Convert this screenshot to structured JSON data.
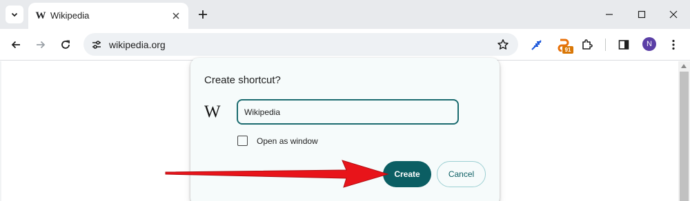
{
  "browser": {
    "tab": {
      "favicon": "W",
      "title": "Wikipedia"
    },
    "omnibox": {
      "url": "wikipedia.org"
    },
    "extension_badge": "91",
    "profile_initial": "N"
  },
  "icons": {
    "tab_search": "chevron-down-icon",
    "tab_close": "close-icon",
    "new_tab": "plus-icon",
    "minimize": "minimize-icon",
    "maximize": "maximize-icon",
    "close_window": "close-icon",
    "back": "arrow-left-icon",
    "forward": "arrow-right-icon",
    "reload": "reload-icon",
    "site_info": "tune-icon",
    "bookmark": "star-icon",
    "extension_1": "feather-icon",
    "extensions": "puzzle-icon",
    "side_panel": "side-panel-icon",
    "menu": "kebab-menu-icon"
  },
  "dialog": {
    "title": "Create shortcut?",
    "site_logo": "W",
    "name_value": "Wikipedia",
    "checkbox_label": "Open as window",
    "checkbox_checked": false,
    "create_label": "Create",
    "cancel_label": "Cancel"
  },
  "colors": {
    "accent": "#0b5e63",
    "input_border": "#1b6b6f",
    "annotation_arrow": "#e8141a",
    "avatar": "#5b3fa6",
    "badge": "#d97706"
  }
}
